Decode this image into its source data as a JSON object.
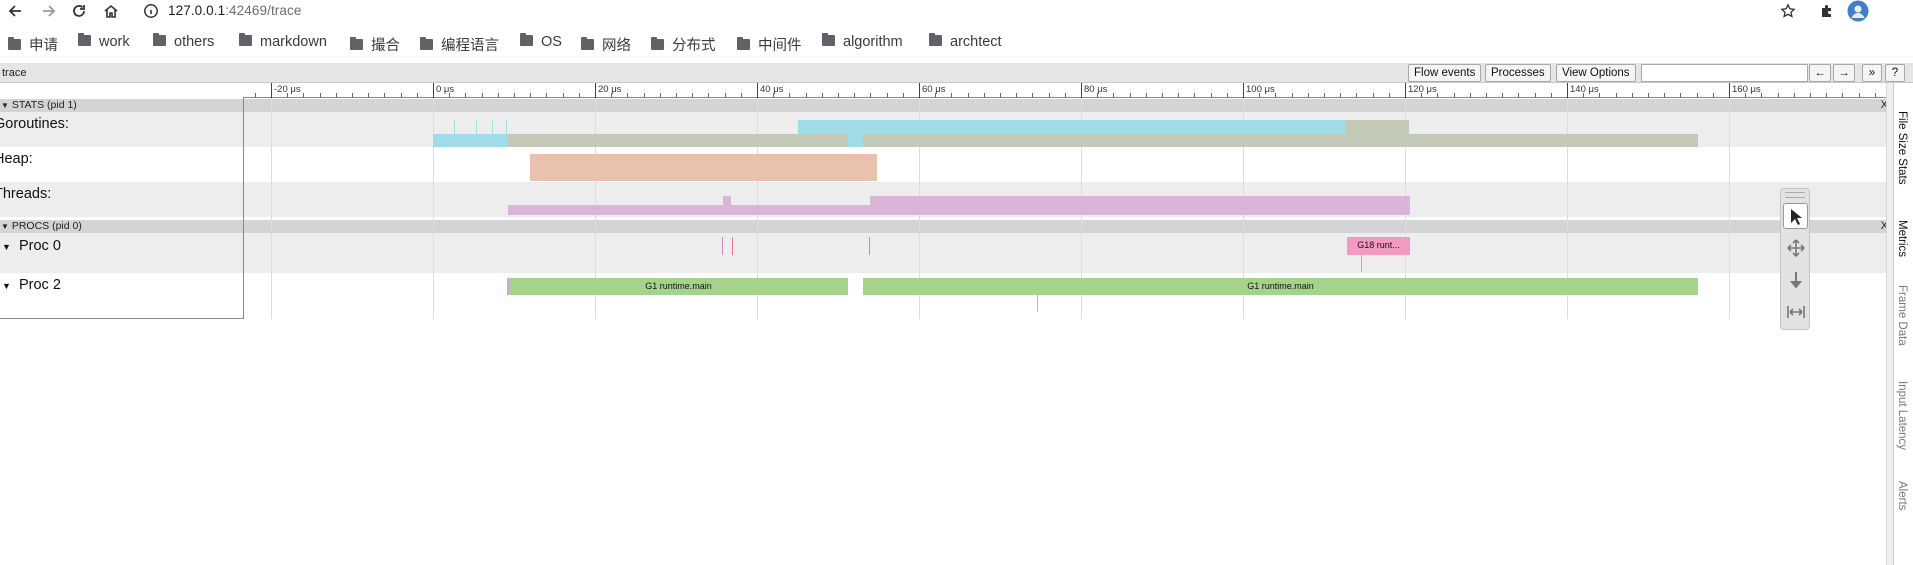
{
  "browser": {
    "url_host": "127.0.0.1",
    "url_rest": ":42469/trace",
    "bookmarks": [
      "申请",
      "work",
      "others",
      "markdown",
      "撮合",
      "编程语言",
      "OS",
      "网络",
      "分布式",
      "中间件",
      "algorithm",
      "archtect"
    ]
  },
  "trace": {
    "title": "trace",
    "buttons": [
      "Flow events",
      "Processes",
      "View Options"
    ],
    "nav": [
      "←",
      "→",
      "»",
      "?"
    ],
    "ruler_ticks": [
      "-20 μs",
      "0 μs",
      "20 μs",
      "40 μs",
      "60 μs",
      "80 μs",
      "100 μs",
      "120 μs",
      "140 μs",
      "160 μs"
    ],
    "groups": {
      "stats": {
        "label": "STATS (pid 1)",
        "close": "X"
      },
      "procs": {
        "label": "PROCS (pid 0)",
        "close": "X"
      }
    },
    "tracks": {
      "goroutines": "Goroutines:",
      "heap": "Heap:",
      "threads": "Threads:",
      "proc0": "Proc 0",
      "proc2": "Proc 2"
    },
    "slices": {
      "g18": "G18 runt...",
      "g1_a": "G1 runtime.main",
      "g1_b": "G1 runtime.main"
    },
    "side_tabs": [
      "File Size Stats",
      "Metrics",
      "Frame Data",
      "Input Latency",
      "Alerts"
    ],
    "colors": {
      "goroutine_running": "#a0dbe8",
      "goroutine_runnable": "#c2c9b7",
      "heap": "#e9c1ad",
      "threads": "#dbb5d7",
      "g18": "#f39ac3",
      "g1": "#a6d38b"
    },
    "mouse_modes": [
      "select-mode",
      "pan-mode",
      "zoom-mode",
      "timing-mode"
    ]
  }
}
